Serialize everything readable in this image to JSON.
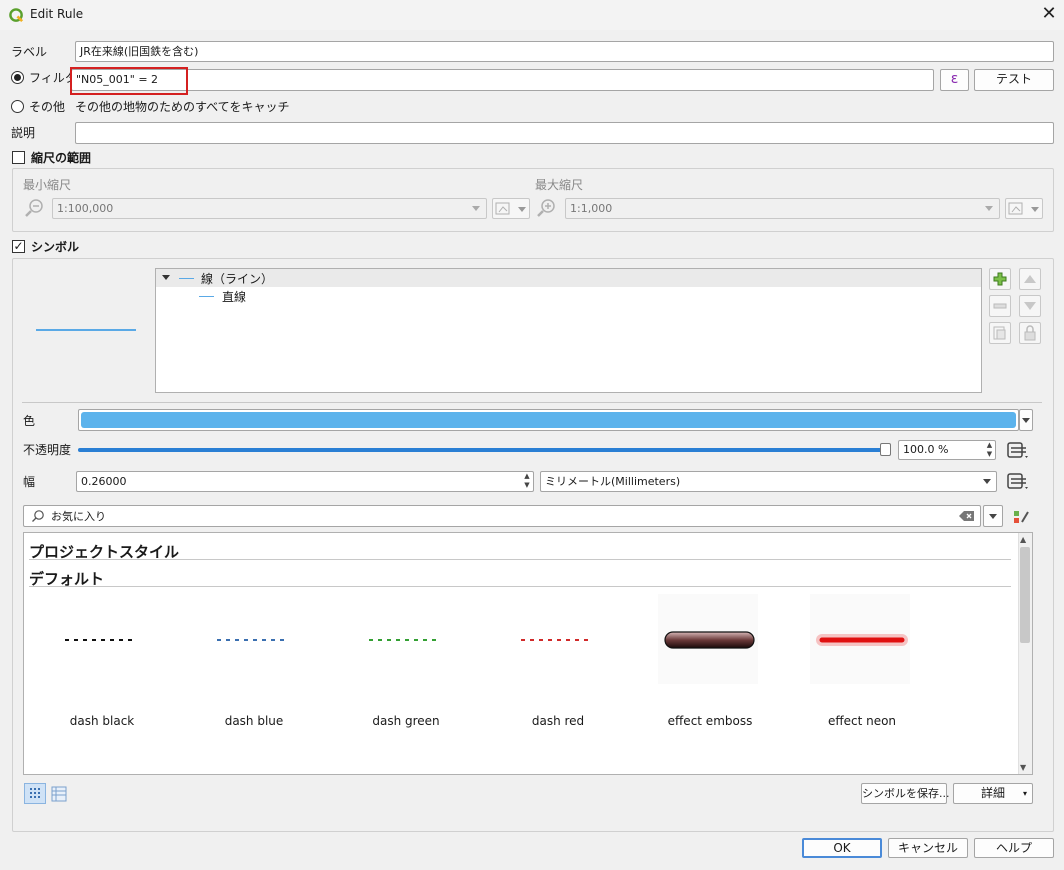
{
  "window": {
    "title": "Edit Rule",
    "close_glyph": "✕"
  },
  "form": {
    "label_caption": "ラベル",
    "label_value": "JR在来線(旧国鉄を含む)",
    "filter_caption": "フィルタ",
    "filter_value": "\"N05_001\" = 2",
    "expression_glyph": "ε",
    "test_label": "テスト",
    "else_caption": "その他",
    "else_desc": "その他の地物のためのすべてをキャッチ",
    "description_caption": "説明",
    "description_value": ""
  },
  "scale": {
    "title": "縮尺の範囲",
    "min_caption": "最小縮尺",
    "min_value": "1:100,000",
    "max_caption": "最大縮尺",
    "max_value": "1:1,000"
  },
  "symbol": {
    "title": "シンボル",
    "tree": {
      "root": "線（ライン）",
      "child": "直線"
    },
    "preview_color": "#5aa9e6"
  },
  "props": {
    "color_caption": "色",
    "color_value": "#5cb3ec",
    "opacity_caption": "不透明度",
    "opacity_value": "100.0 %",
    "opacity_fraction": 1.0,
    "width_caption": "幅",
    "width_value": "0.26000",
    "unit_value": "ミリメートル(Millimeters)"
  },
  "library": {
    "search_placeholder": "お気に入り",
    "section_project": "プロジェクトスタイル",
    "section_default": "デフォルト",
    "symbols": [
      {
        "name": "dash  black",
        "color": "#111111"
      },
      {
        "name": "dash blue",
        "color": "#3a6fb0"
      },
      {
        "name": "dash green",
        "color": "#33a033"
      },
      {
        "name": "dash red",
        "color": "#d12a2a"
      },
      {
        "name": "effect emboss",
        "color": "#6b3a3a"
      },
      {
        "name": "effect neon",
        "color": "#e01010"
      }
    ],
    "save_symbol_label": "シンボルを保存...",
    "advanced_label": "詳細"
  },
  "footer": {
    "ok": "OK",
    "cancel": "キャンセル",
    "help": "ヘルプ"
  }
}
